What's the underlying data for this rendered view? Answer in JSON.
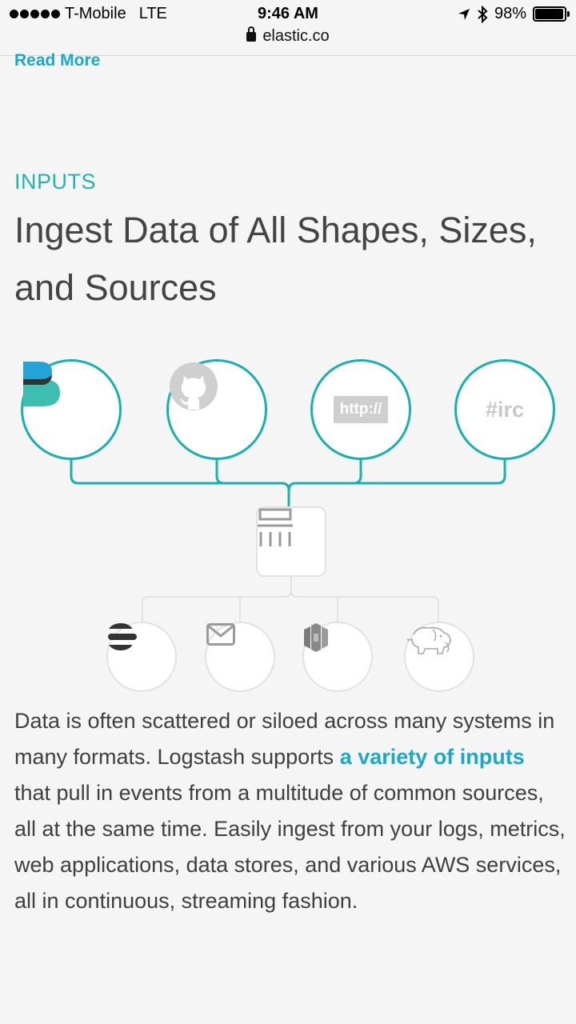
{
  "status": {
    "carrier": "T-Mobile",
    "network": "LTE",
    "time": "9:46 AM",
    "battery": "98%",
    "battery_level": 0.98
  },
  "browser": {
    "url": "elastic.co"
  },
  "page": {
    "read_more": "Read More",
    "section_label": "INPUTS",
    "headline": "Ingest Data of All Shapes, Sizes, and Sources",
    "inputs": [
      {
        "name": "beats",
        "icon": "beats-icon"
      },
      {
        "name": "github",
        "icon": "github-icon"
      },
      {
        "name": "http",
        "icon": "http-icon",
        "label": "http://"
      },
      {
        "name": "irc",
        "icon": "irc-icon",
        "label": "#irc"
      }
    ],
    "hub_icon": "logstash-pipeline-icon",
    "outputs": [
      {
        "name": "elasticsearch",
        "icon": "elasticsearch-icon"
      },
      {
        "name": "email",
        "icon": "email-icon"
      },
      {
        "name": "aws-s3",
        "icon": "aws-s3-icon"
      },
      {
        "name": "hadoop",
        "icon": "hadoop-elephant-icon"
      }
    ],
    "body_before_link": "Data is often scattered or siloed across many systems in many formats. Logstash supports ",
    "body_link": "a variety of inputs",
    "body_after_link": " that pull in events from a multitude of common sources, all at the same time. Easily ingest from your logs, metrics, web applications, data stores, and various AWS services, all in continuous, streaming fashion."
  },
  "colors": {
    "accent_teal": "#17b1ae",
    "link_blue": "#1ba9c9"
  }
}
